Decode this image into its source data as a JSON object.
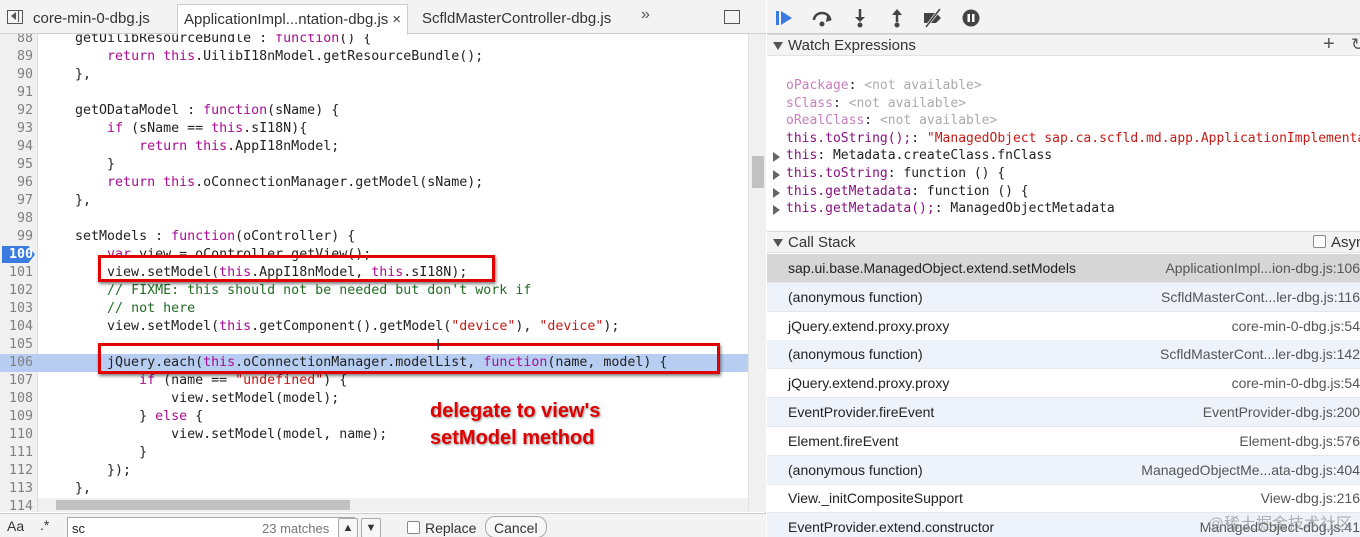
{
  "tabs": [
    {
      "label": "core-min-0-dbg.js",
      "active": false
    },
    {
      "label": "ApplicationImpl...ntation-dbg.js",
      "active": true,
      "close": "×"
    },
    {
      "label": "ScfldMasterController-dbg.js",
      "active": false
    }
  ],
  "tab_overflow": "»",
  "code_lines": [
    {
      "n": "88",
      "html": "    getUilibResourceBundle : <span class=\"kw\">function</span>() {"
    },
    {
      "n": "89",
      "html": "        <span class=\"kw\">return this</span>.UilibI18nModel.getResourceBundle();"
    },
    {
      "n": "90",
      "html": "    },"
    },
    {
      "n": "91",
      "html": ""
    },
    {
      "n": "92",
      "html": "    getODataModel : <span class=\"kw\">function</span>(sName) {"
    },
    {
      "n": "93",
      "html": "        <span class=\"kw\">if</span> (sName == <span class=\"kw\">this</span>.sI18N){"
    },
    {
      "n": "94",
      "html": "            <span class=\"kw\">return this</span>.AppI18nModel;"
    },
    {
      "n": "95",
      "html": "        }"
    },
    {
      "n": "96",
      "html": "        <span class=\"kw\">return this</span>.oConnectionManager.getModel(sName);"
    },
    {
      "n": "97",
      "html": "    },"
    },
    {
      "n": "98",
      "html": ""
    },
    {
      "n": "99",
      "html": "    setModels : <span class=\"kw\">function</span>(oController) {"
    },
    {
      "n": "100",
      "html": "        <span class=\"kw\">var</span> view = oController.getView();",
      "breakpoint": true
    },
    {
      "n": "101",
      "html": "        view.setModel(<span class=\"kw\">this</span>.AppI18nModel, <span class=\"kw\">this</span>.sI18N);"
    },
    {
      "n": "102",
      "html": "        <span class=\"cmt\">// FIXME: this should not be needed but don't work if</span>"
    },
    {
      "n": "103",
      "html": "        <span class=\"cmt\">// not here</span>"
    },
    {
      "n": "104",
      "html": "        view.setModel(<span class=\"kw\">this</span>.getComponent().getModel(<span class=\"str\">\"device\"</span>), <span class=\"str\">\"device\"</span>);"
    },
    {
      "n": "105",
      "html": ""
    },
    {
      "n": "106",
      "html": "        jQuery.each(<span class=\"kw\">this</span>.oConnectionManager.modelList, <span class=\"kw\">function</span>(name, model) {",
      "exec": true
    },
    {
      "n": "107",
      "html": "            <span class=\"kw\">if</span> (name == <span class=\"str\">\"undefined\"</span>) {"
    },
    {
      "n": "108",
      "html": "                view.setModel(model);"
    },
    {
      "n": "109",
      "html": "            } <span class=\"kw\">else</span> {"
    },
    {
      "n": "110",
      "html": "                view.setModel(model, name);"
    },
    {
      "n": "111",
      "html": "            }"
    },
    {
      "n": "112",
      "html": "        });"
    },
    {
      "n": "113",
      "html": "    },"
    },
    {
      "n": "114",
      "html": ""
    }
  ],
  "annotation": {
    "line1": "delegate to view's",
    "line2": "setModel method"
  },
  "search": {
    "aa": "Aa",
    "regex": ".*",
    "value": "sc",
    "matches": "23 matches",
    "up": "▲",
    "down": "▼",
    "replace_label": "Replace",
    "cancel_label": "Cancel"
  },
  "watch": {
    "title": "Watch Expressions",
    "add": "+",
    "refresh": "↻",
    "items": [
      {
        "key": "oPackage",
        "sep": ": ",
        "value": "<not available>",
        "dim": true
      },
      {
        "key": "sClass",
        "sep": ": ",
        "value": "<not available>",
        "dim": true
      },
      {
        "key": "oRealClass",
        "sep": ": ",
        "value": "<not available>",
        "dim": true
      },
      {
        "key": "this.toString();",
        "sep": ": ",
        "value": "\"ManagedObject sap.ca.scfld.md.app.ApplicationImplementation\"",
        "string": true
      },
      {
        "key": "this",
        "sep": ": ",
        "value": "Metadata.createClass.fnClass",
        "expandable": true
      },
      {
        "key": "this.toString",
        "sep": ": ",
        "value": "function () {",
        "expandable": true
      },
      {
        "key": "this.getMetadata",
        "sep": ": ",
        "value": "function () {",
        "expandable": true
      },
      {
        "key": "this.getMetadata();",
        "sep": ": ",
        "value": "ManagedObjectMetadata",
        "expandable": true
      }
    ]
  },
  "callstack": {
    "title": "Call Stack",
    "async_label": "Async",
    "frames": [
      {
        "fn": "sap.ui.base.ManagedObject.extend.setModels",
        "loc": "ApplicationImpl...ion-dbg.js:106",
        "selected": true
      },
      {
        "fn": "(anonymous function)",
        "loc": "ScfldMasterCont...ler-dbg.js:116"
      },
      {
        "fn": "jQuery.extend.proxy.proxy",
        "loc": "core-min-0-dbg.js:54"
      },
      {
        "fn": "(anonymous function)",
        "loc": "ScfldMasterCont...ler-dbg.js:142"
      },
      {
        "fn": "jQuery.extend.proxy.proxy",
        "loc": "core-min-0-dbg.js:54"
      },
      {
        "fn": "EventProvider.fireEvent",
        "loc": "EventProvider-dbg.js:200"
      },
      {
        "fn": "Element.fireEvent",
        "loc": "Element-dbg.js:576"
      },
      {
        "fn": "(anonymous function)",
        "loc": "ManagedObjectMe...ata-dbg.js:404"
      },
      {
        "fn": "View._initCompositeSupport",
        "loc": "View-dbg.js:216"
      },
      {
        "fn": "EventProvider.extend.constructor",
        "loc": "ManagedObject-dbg.js:41"
      }
    ]
  },
  "watermark": "@稀土掘金技术社区",
  "colors": {
    "accent": "#3b7be0",
    "exec_line": "#b7cdf2",
    "annotation": "#e00000"
  }
}
